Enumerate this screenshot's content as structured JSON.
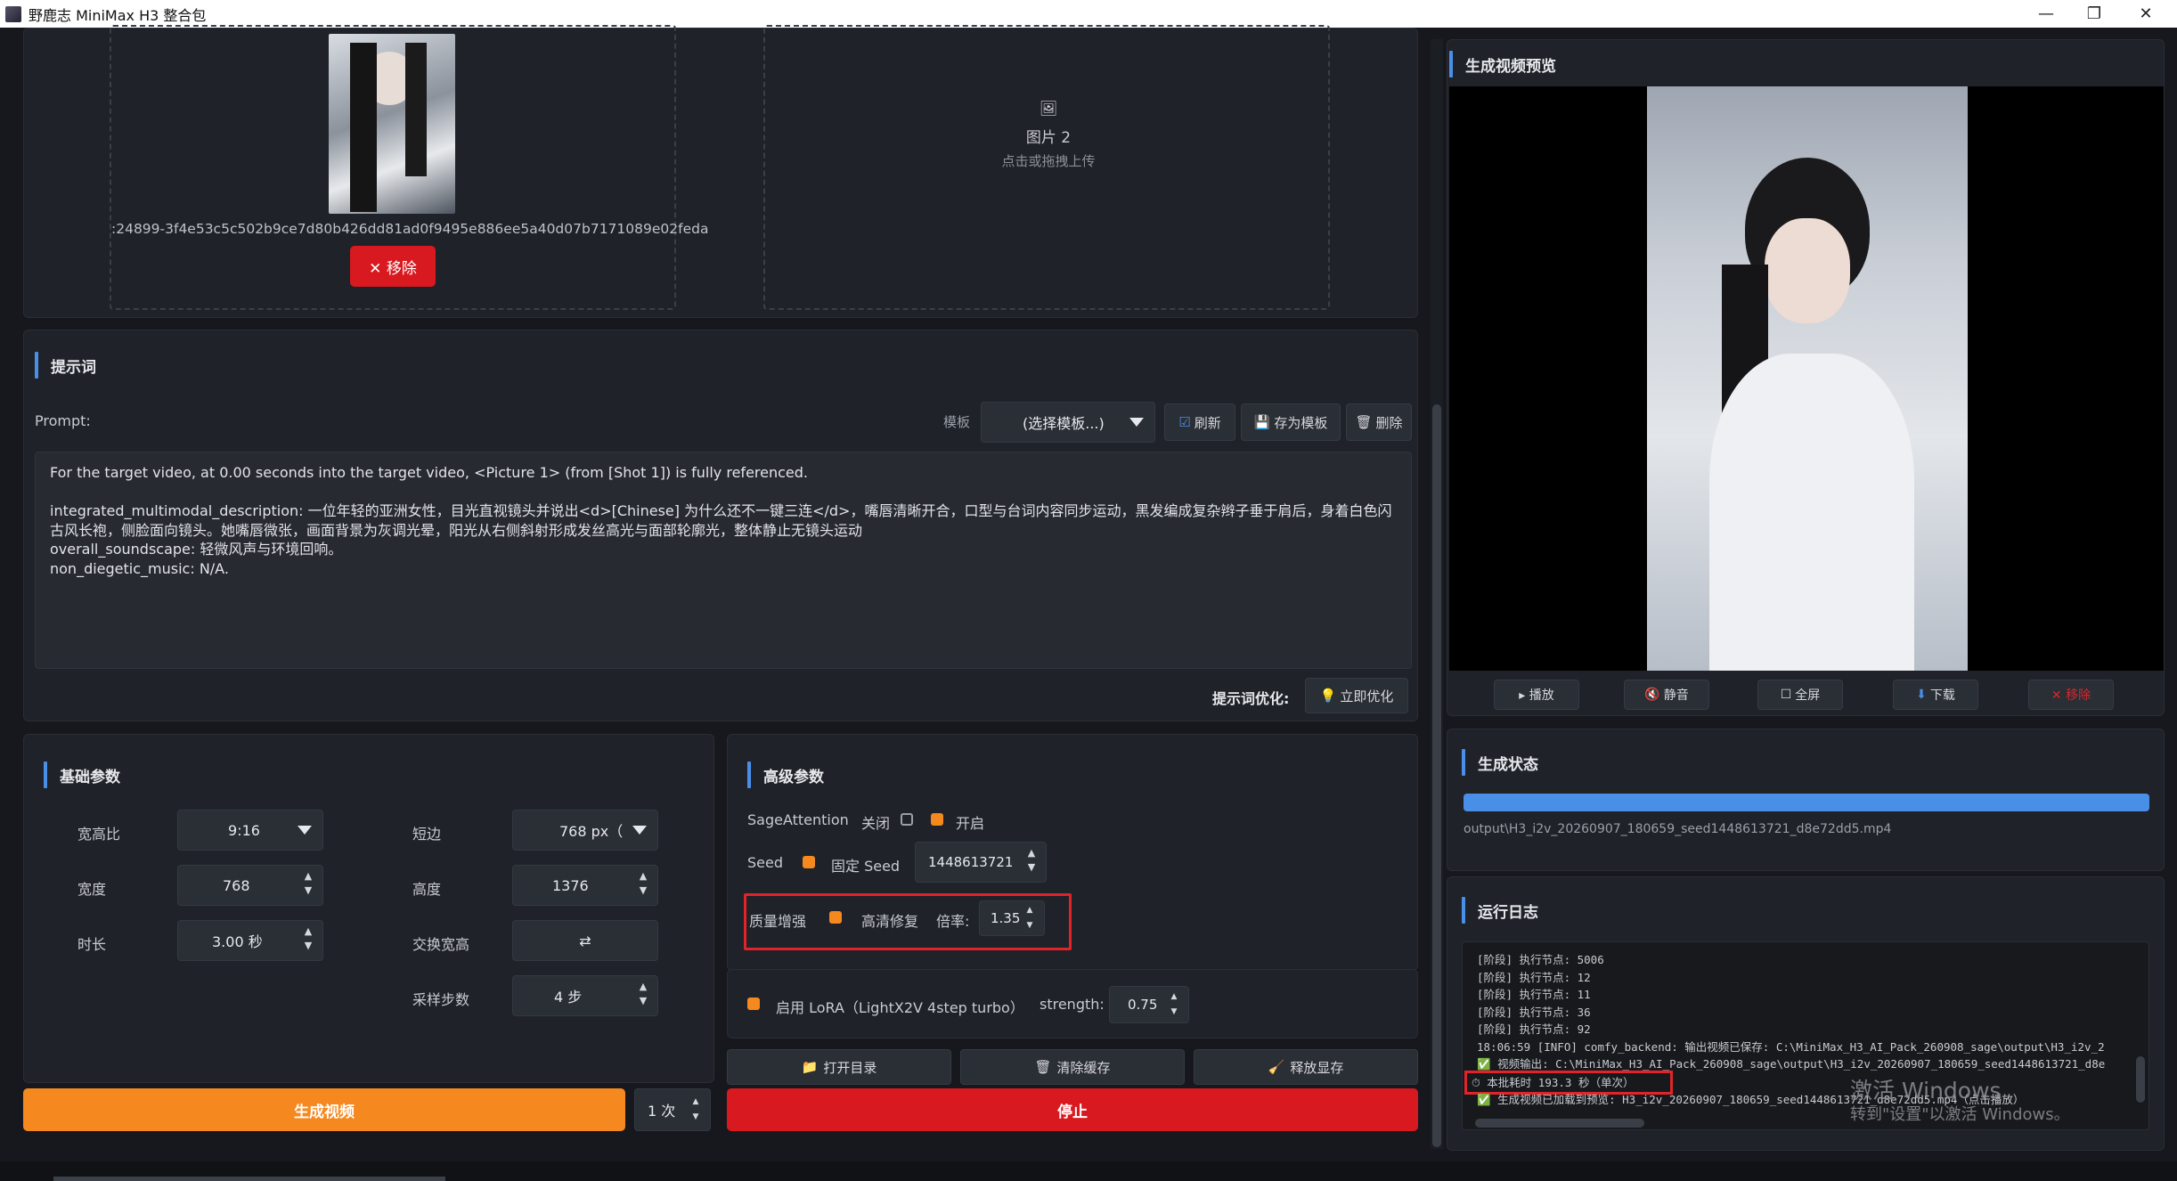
{
  "window": {
    "title": "野鹿志 MiniMax H3 整合包",
    "minimize": "—",
    "restore": "❐",
    "close": "✕"
  },
  "images": {
    "img1_filename": ":24899-3f4e53c5c502b9ce7d80b426dd81ad0f9495e886ee5a40d07b7171089e02feda",
    "img1_remove": "✕ 移除",
    "img2_icon": "🖼",
    "img2_label": "图片 2",
    "img2_hint": "点击或拖拽上传"
  },
  "prompt": {
    "section_title": "提示词",
    "label": "Prompt:",
    "template_label": "模板",
    "template_select": "(选择模板...)",
    "refresh": "刷新",
    "save_template": "存为模板",
    "delete": "删除",
    "lines": [
      "For the target video, at 0.00 seconds into the target video, <Picture 1> (from [Shot 1]) is fully referenced.",
      "",
      "integrated_multimodal_description: 一位年轻的亚洲女性，目光直视镜头并说出<d>[Chinese] 为什么还不一键三连</d>，嘴唇清晰开合，口型与台词内容同步运动，黑发编成复杂辫子垂于肩后，身着白色闪",
      "古风长袍，侧脸面向镜头。她嘴唇微张，画面背景为灰调光晕，阳光从右侧斜射形成发丝高光与面部轮廓光，整体静止无镜头运动",
      "overall_soundscape: 轻微风声与环境回响。",
      "non_diegetic_music: N/A."
    ],
    "optimize_label": "提示词优化:",
    "optimize_btn": "立即优化"
  },
  "basic": {
    "title": "基础参数",
    "aspect_label": "宽高比",
    "aspect_value": "9:16",
    "short_label": "短边",
    "short_value": "768 px（",
    "width_label": "宽度",
    "width_value": "768",
    "height_label": "高度",
    "height_value": "1376",
    "duration_label": "时长",
    "duration_value": "3.00 秒",
    "swap_label": "交换宽高",
    "swap_icon": "⇄",
    "steps_label": "采样步数",
    "steps_value": "4 步"
  },
  "advanced": {
    "title": "高级参数",
    "sage_label": "SageAttention",
    "sage_off": "关闭",
    "sage_on": "开启",
    "seed_label": "Seed",
    "seed_fixed": "固定 Seed",
    "seed_value": "1448613721",
    "quality_label": "质量增强",
    "hd_label": "高清修复",
    "ratio_label": "倍率:",
    "ratio_value": "1.35"
  },
  "lora": {
    "label": "启用 LoRA（LightX2V 4step turbo）",
    "strength_label": "strength:",
    "strength_value": "0.75"
  },
  "utils": {
    "open_dir": "打开目录",
    "clear_cache": "清除缓存",
    "free_vram": "释放显存"
  },
  "actions": {
    "generate": "生成视频",
    "count": "1 次",
    "stop": "停止"
  },
  "preview": {
    "title": "生成视频预览",
    "play": "▸ 播放",
    "mute": "静音",
    "fullscreen": "全屏",
    "download": "下载",
    "remove": "✕ 移除"
  },
  "status": {
    "title": "生成状态",
    "progress": 1.0,
    "output_path": "output\\H3_i2v_20260907_180659_seed1448613721_d8e72dd5.mp4"
  },
  "log": {
    "title": "运行日志",
    "lines": [
      "[阶段] 执行节点: 5006",
      "[阶段] 执行节点: 12",
      "[阶段] 执行节点: 11",
      "[阶段] 执行节点: 36",
      "[阶段] 执行节点: 92",
      "18:06:59 [INFO] comfy_backend: 输出视频已保存: C:\\MiniMax_H3_AI_Pack_260908_sage\\output\\H3_i2v_2",
      "✅ 视频输出: C:\\MiniMax_H3_AI_Pack_260908_sage\\output\\H3_i2v_20260907_180659_seed1448613721_d8e",
      "⏱ 本批耗时 193.3 秒（单次）",
      "✅ 生成视频已加载到预览: H3_i2v_20260907_180659_seed1448613721_d8e72dd5.mp4（点击播放）"
    ]
  },
  "watermark": {
    "line1": "激活 Windows",
    "line2": "转到\"设置\"以激活 Windows。"
  },
  "colors": {
    "accent_blue": "#4a8fe7",
    "orange": "#f5881f",
    "red": "#d8191f",
    "highlight_box": "#e0242a"
  }
}
